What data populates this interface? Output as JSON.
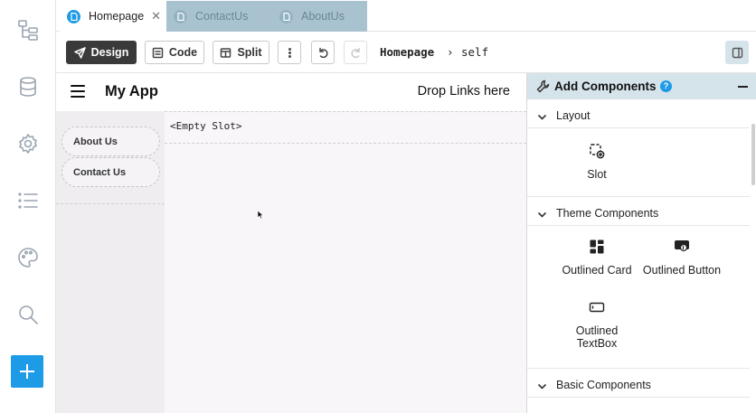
{
  "rail": {
    "items": [
      {
        "name": "pages-tree-icon"
      },
      {
        "name": "database-icon"
      },
      {
        "name": "settings-gear-icon"
      },
      {
        "name": "list-icon"
      },
      {
        "name": "palette-icon"
      },
      {
        "name": "search-icon"
      }
    ],
    "add_icon": "plus-icon",
    "accent": "#1e9be6"
  },
  "tabs": [
    {
      "label": "Homepage",
      "active": true
    },
    {
      "label": "ContactUs",
      "active": false
    },
    {
      "label": "AboutUs",
      "active": false
    }
  ],
  "toolbar": {
    "design_label": "Design",
    "code_label": "Code",
    "split_label": "Split",
    "breadcrumb_page": "Homepage",
    "breadcrumb_sep": "›",
    "breadcrumb_self": "self"
  },
  "canvas": {
    "app_title": "My App",
    "drop_links": "Drop Links here",
    "nav_items": [
      "About Us",
      "Contact Us"
    ],
    "slot_text": "<Empty Slot>"
  },
  "panel": {
    "title": "Add Components",
    "help": "?",
    "sections": {
      "layout": "Layout",
      "theme": "Theme Components",
      "basic": "Basic Components"
    },
    "layout_items": [
      "Slot"
    ],
    "theme_items": [
      "Outlined Card",
      "Outlined Button",
      "Outlined TextBox"
    ]
  }
}
